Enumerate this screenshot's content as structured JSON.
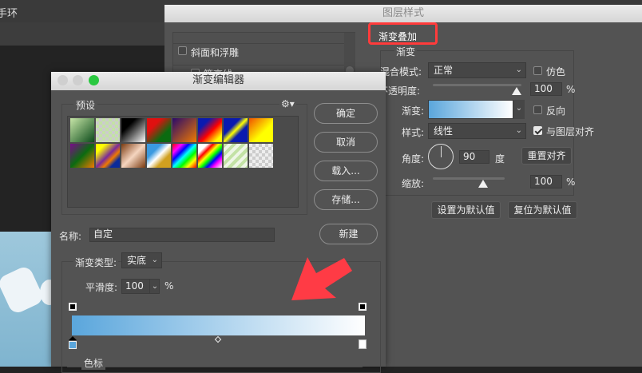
{
  "background": {
    "app_title_partial": "手环"
  },
  "layer_style": {
    "title": "图层样式",
    "list_items": [
      {
        "label": "斜面和浮雕",
        "checked": false
      },
      {
        "label": "等高线",
        "checked": false
      }
    ],
    "section_title": "渐变叠加",
    "group_title": "渐变",
    "blend_mode": {
      "label": "混合模式:",
      "value": "正常"
    },
    "dither": {
      "label": "仿色",
      "checked": false
    },
    "opacity": {
      "label": "不透明度:",
      "value": "100",
      "unit": "%",
      "fraction": 1.0
    },
    "gradient": {
      "label": "渐变:",
      "start_color": "#5aa6dc",
      "end_color": "#ffffff"
    },
    "reverse": {
      "label": "反向",
      "checked": false
    },
    "style": {
      "label": "样式:",
      "value": "线性"
    },
    "align_with_layer": {
      "label": "与图层对齐",
      "checked": true
    },
    "angle": {
      "label": "角度:",
      "value": "90",
      "unit": "度"
    },
    "reset_align": "重置对齐",
    "scale": {
      "label": "缩放:",
      "value": "100",
      "unit": "%",
      "fraction": 0.5
    },
    "set_default": "设置为默认值",
    "reset_default": "复位为默认值",
    "highlight_color": "#ff3b3b"
  },
  "gradient_editor": {
    "title": "渐变编辑器",
    "presets_label": "预设",
    "buttons": {
      "ok": "确定",
      "cancel": "取消",
      "load": "载入...",
      "save": "存储...",
      "new": "新建"
    },
    "name": {
      "label": "名称:",
      "value": "自定"
    },
    "type": {
      "label": "渐变类型:",
      "value": "实底"
    },
    "smoothness": {
      "label": "平滑度:",
      "value": "100",
      "unit": "%"
    },
    "stops_label": "色标",
    "stops": {
      "left_color": "#5aa6dc",
      "right_color": "#ffffff",
      "midpoint": 0.5
    }
  }
}
